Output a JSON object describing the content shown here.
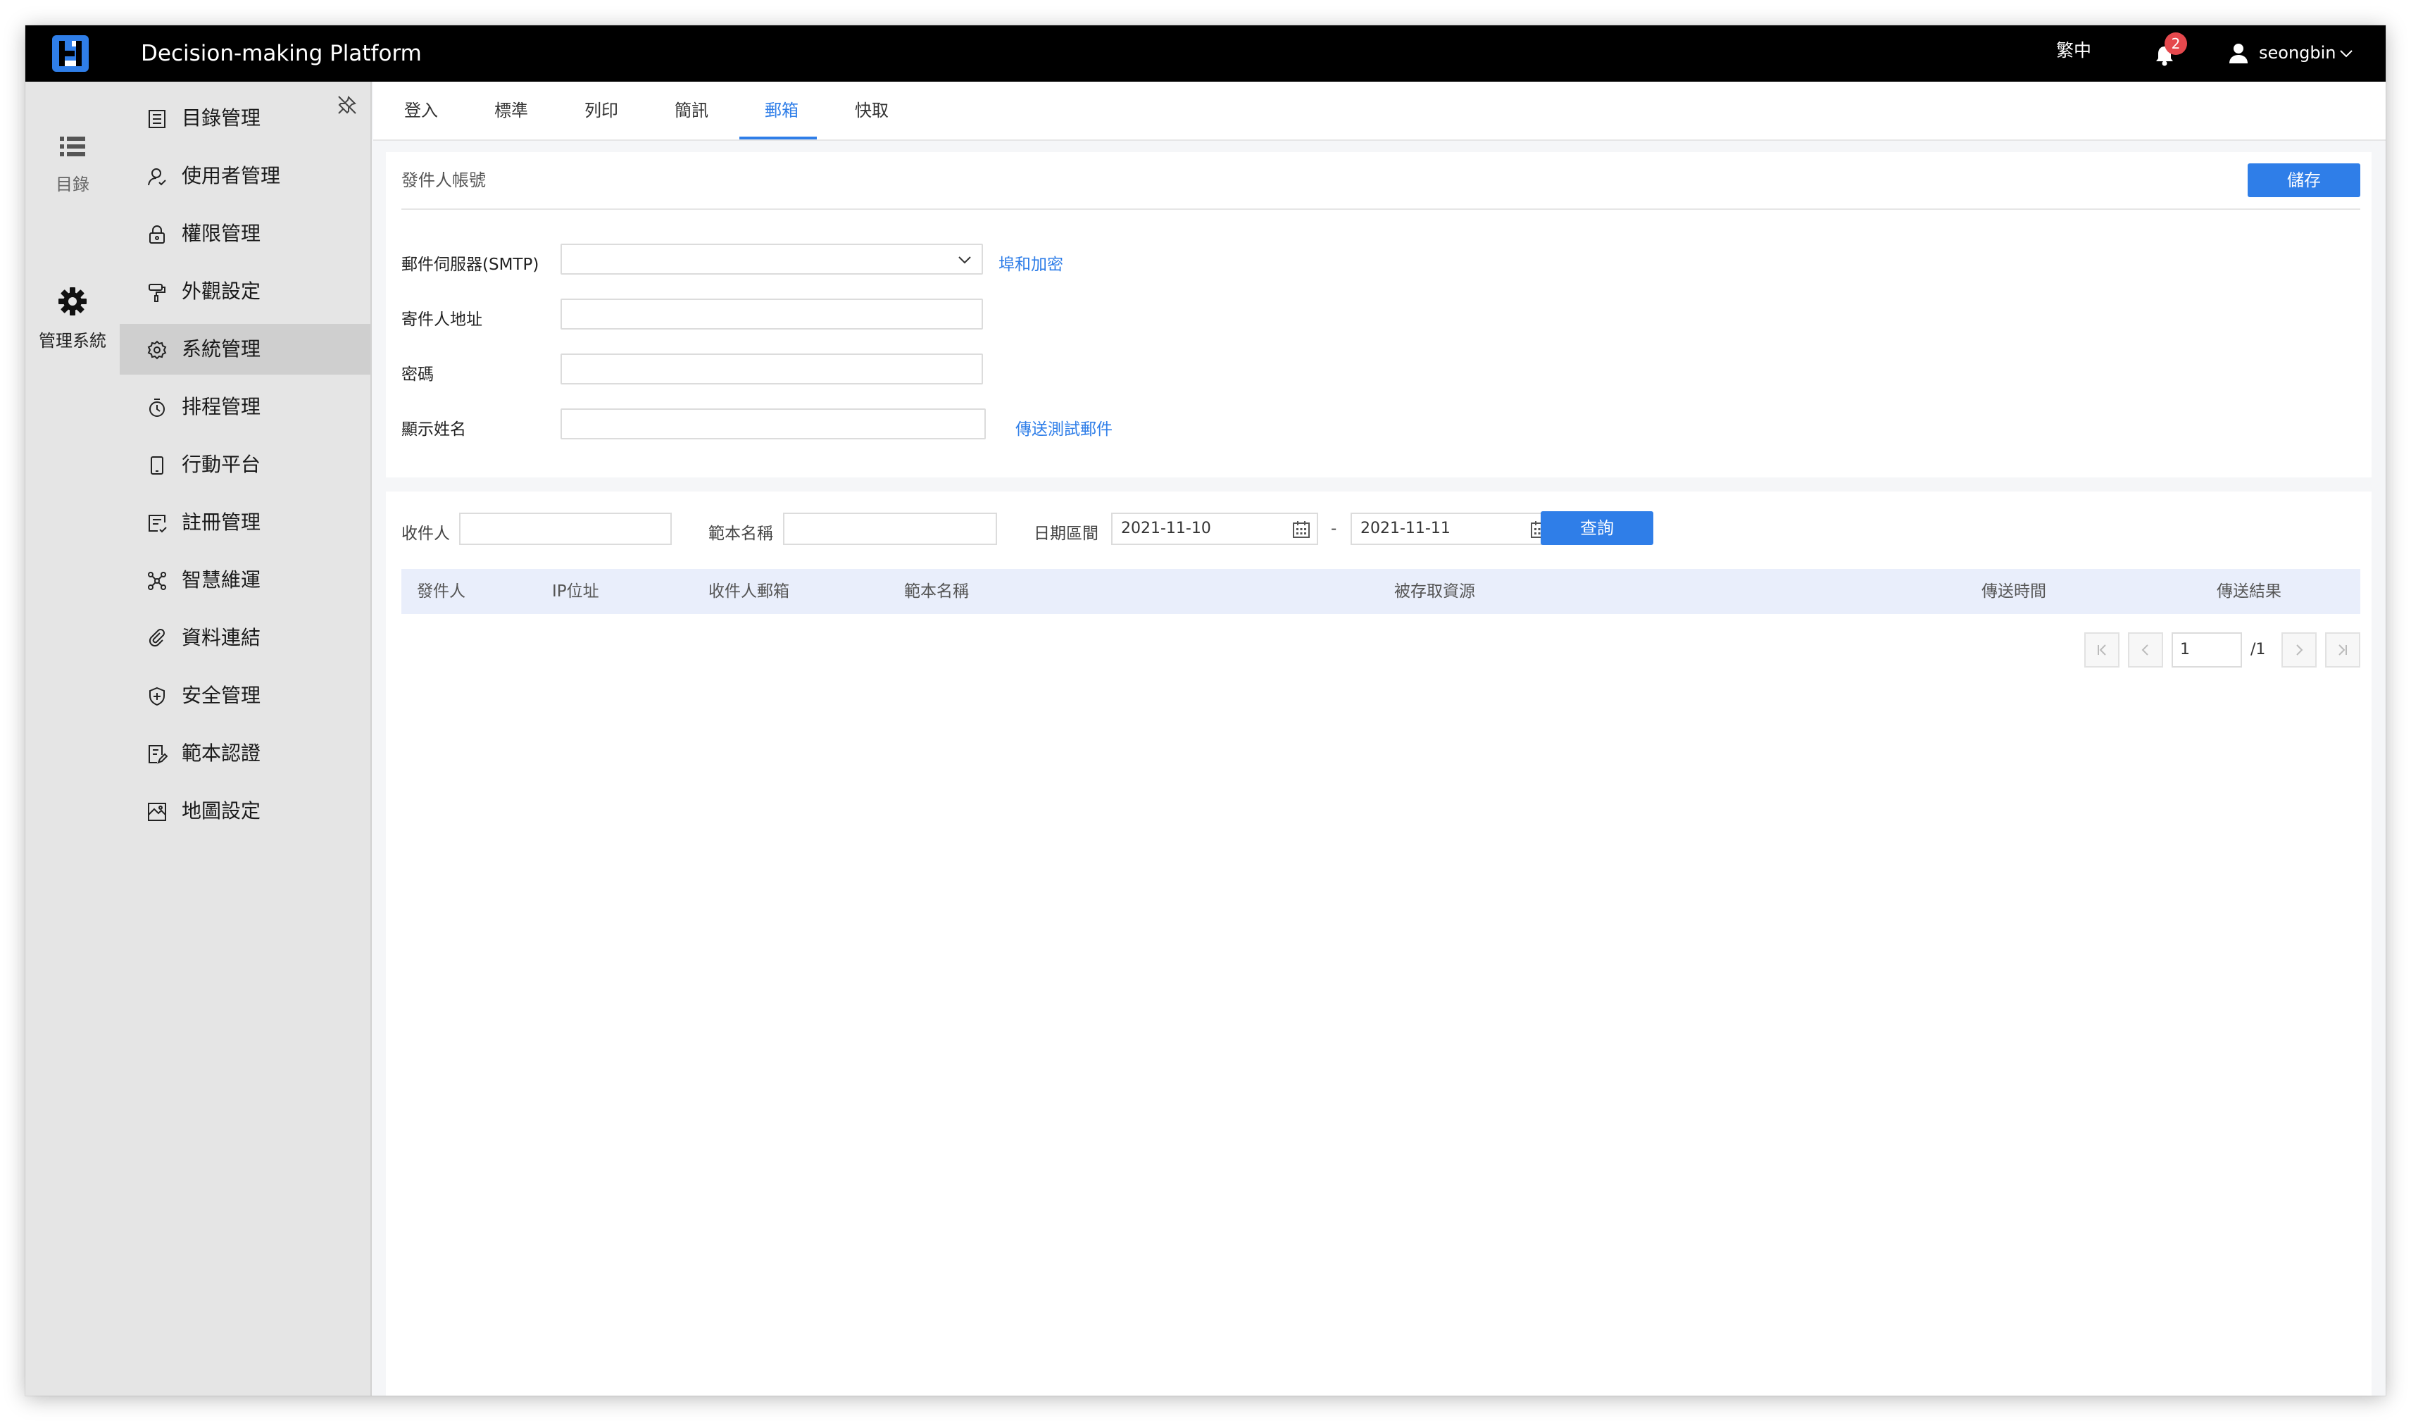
{
  "app": {
    "title": "Decision-making Platform"
  },
  "header": {
    "language": "繁中",
    "notification_count": "2",
    "username": "seongbin"
  },
  "rail": {
    "items": [
      {
        "label": "目錄",
        "icon": "list-icon"
      },
      {
        "label": "管理系統",
        "icon": "gear-icon"
      }
    ]
  },
  "menu": {
    "items": [
      {
        "label": "目錄管理",
        "icon": "catalog-icon"
      },
      {
        "label": "使用者管理",
        "icon": "user-icon"
      },
      {
        "label": "權限管理",
        "icon": "lock-icon"
      },
      {
        "label": "外觀設定",
        "icon": "paint-roller-icon"
      },
      {
        "label": "系統管理",
        "icon": "settings-icon",
        "active": true
      },
      {
        "label": "排程管理",
        "icon": "timer-icon"
      },
      {
        "label": "行動平台",
        "icon": "mobile-icon"
      },
      {
        "label": "註冊管理",
        "icon": "register-icon"
      },
      {
        "label": "智慧維運",
        "icon": "network-icon"
      },
      {
        "label": "資料連結",
        "icon": "link-icon"
      },
      {
        "label": "安全管理",
        "icon": "shield-icon"
      },
      {
        "label": "範本認證",
        "icon": "template-icon"
      },
      {
        "label": "地圖設定",
        "icon": "map-icon"
      }
    ]
  },
  "tabs": [
    {
      "label": "登入"
    },
    {
      "label": "標準"
    },
    {
      "label": "列印"
    },
    {
      "label": "簡訊"
    },
    {
      "label": "郵箱",
      "active": true
    },
    {
      "label": "快取"
    }
  ],
  "sender_account": {
    "title": "發件人帳號",
    "save_label": "儲存",
    "fields": {
      "smtp": {
        "label": "郵件伺服器(SMTP)",
        "value": "",
        "link": "埠和加密"
      },
      "from_address": {
        "label": "寄件人地址",
        "value": ""
      },
      "password": {
        "label": "密碼",
        "value": ""
      },
      "display_name": {
        "label": "顯示姓名",
        "value": "",
        "link": "傳送測試郵件"
      }
    }
  },
  "query": {
    "recipient_label": "收件人",
    "recipient_value": "",
    "template_label": "範本名稱",
    "template_value": "",
    "date_range_label": "日期區間",
    "date_from": "2021-11-10",
    "date_sep": "-",
    "date_to": "2021-11-11",
    "query_label": "查詢"
  },
  "table": {
    "columns": [
      "發件人",
      "IP位址",
      "收件人郵箱",
      "範本名稱",
      "被存取資源",
      "傳送時間",
      "傳送結果"
    ],
    "rows": []
  },
  "pagination": {
    "current_page": "1",
    "total_pages": "/1"
  },
  "colors": {
    "accent": "#2f7ee8",
    "header_bg": "#000000",
    "sidebar_bg": "#e5e5e5",
    "active_menu_bg": "#cfcfcf",
    "table_header_bg": "#e9eefb",
    "badge": "#e5484d"
  }
}
